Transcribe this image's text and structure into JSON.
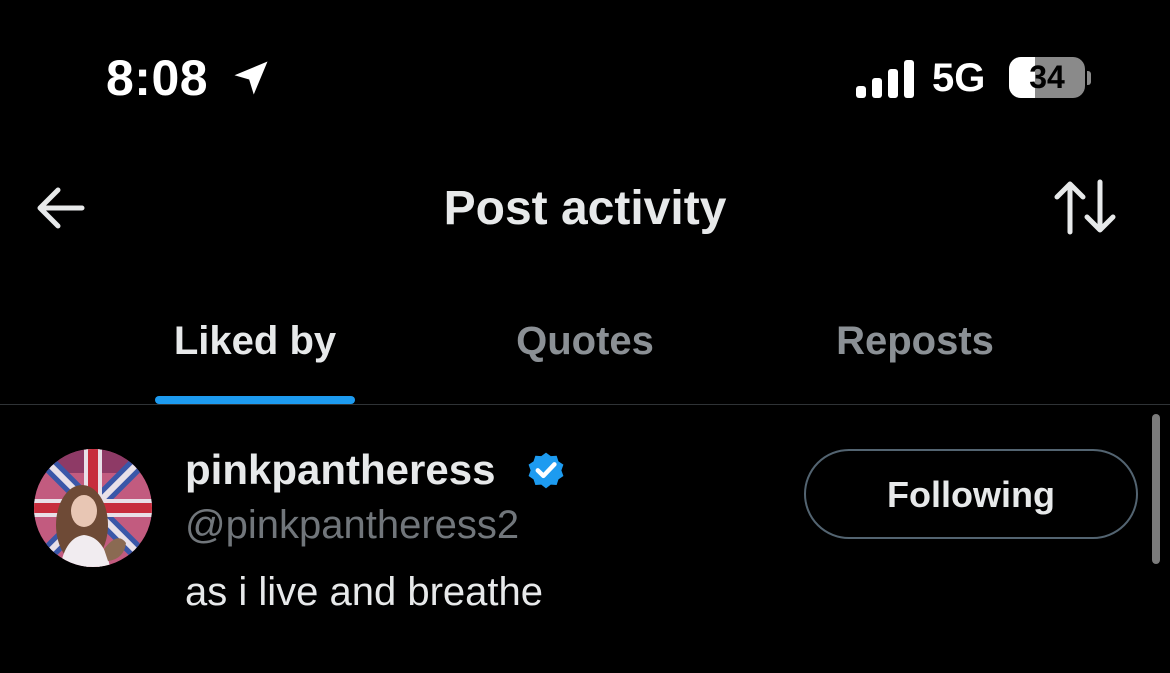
{
  "status_bar": {
    "time": "8:08",
    "network": "5G",
    "battery": "34",
    "battery_level_percent": 34,
    "icons": [
      "location-arrow-icon",
      "cellular-signal-icon",
      "battery-icon"
    ]
  },
  "header": {
    "title": "Post activity",
    "back_icon": "arrow-left-icon",
    "sort_icon": "sort-arrows-icon"
  },
  "tabs": [
    {
      "label": "Liked by",
      "active": true
    },
    {
      "label": "Quotes",
      "active": false
    },
    {
      "label": "Reposts",
      "active": false
    }
  ],
  "users": [
    {
      "display_name": "pinkpantheress",
      "handle": "@pinkpantheress2",
      "verified": true,
      "bio": "as i live and breathe",
      "follow_button_label": "Following"
    }
  ],
  "colors": {
    "background": "#000000",
    "accent": "#1d9bf0",
    "primary_text": "#e7e9ea",
    "secondary_text": "#71767b",
    "inactive_tab": "#8b9095",
    "divider": "#2f3336"
  }
}
